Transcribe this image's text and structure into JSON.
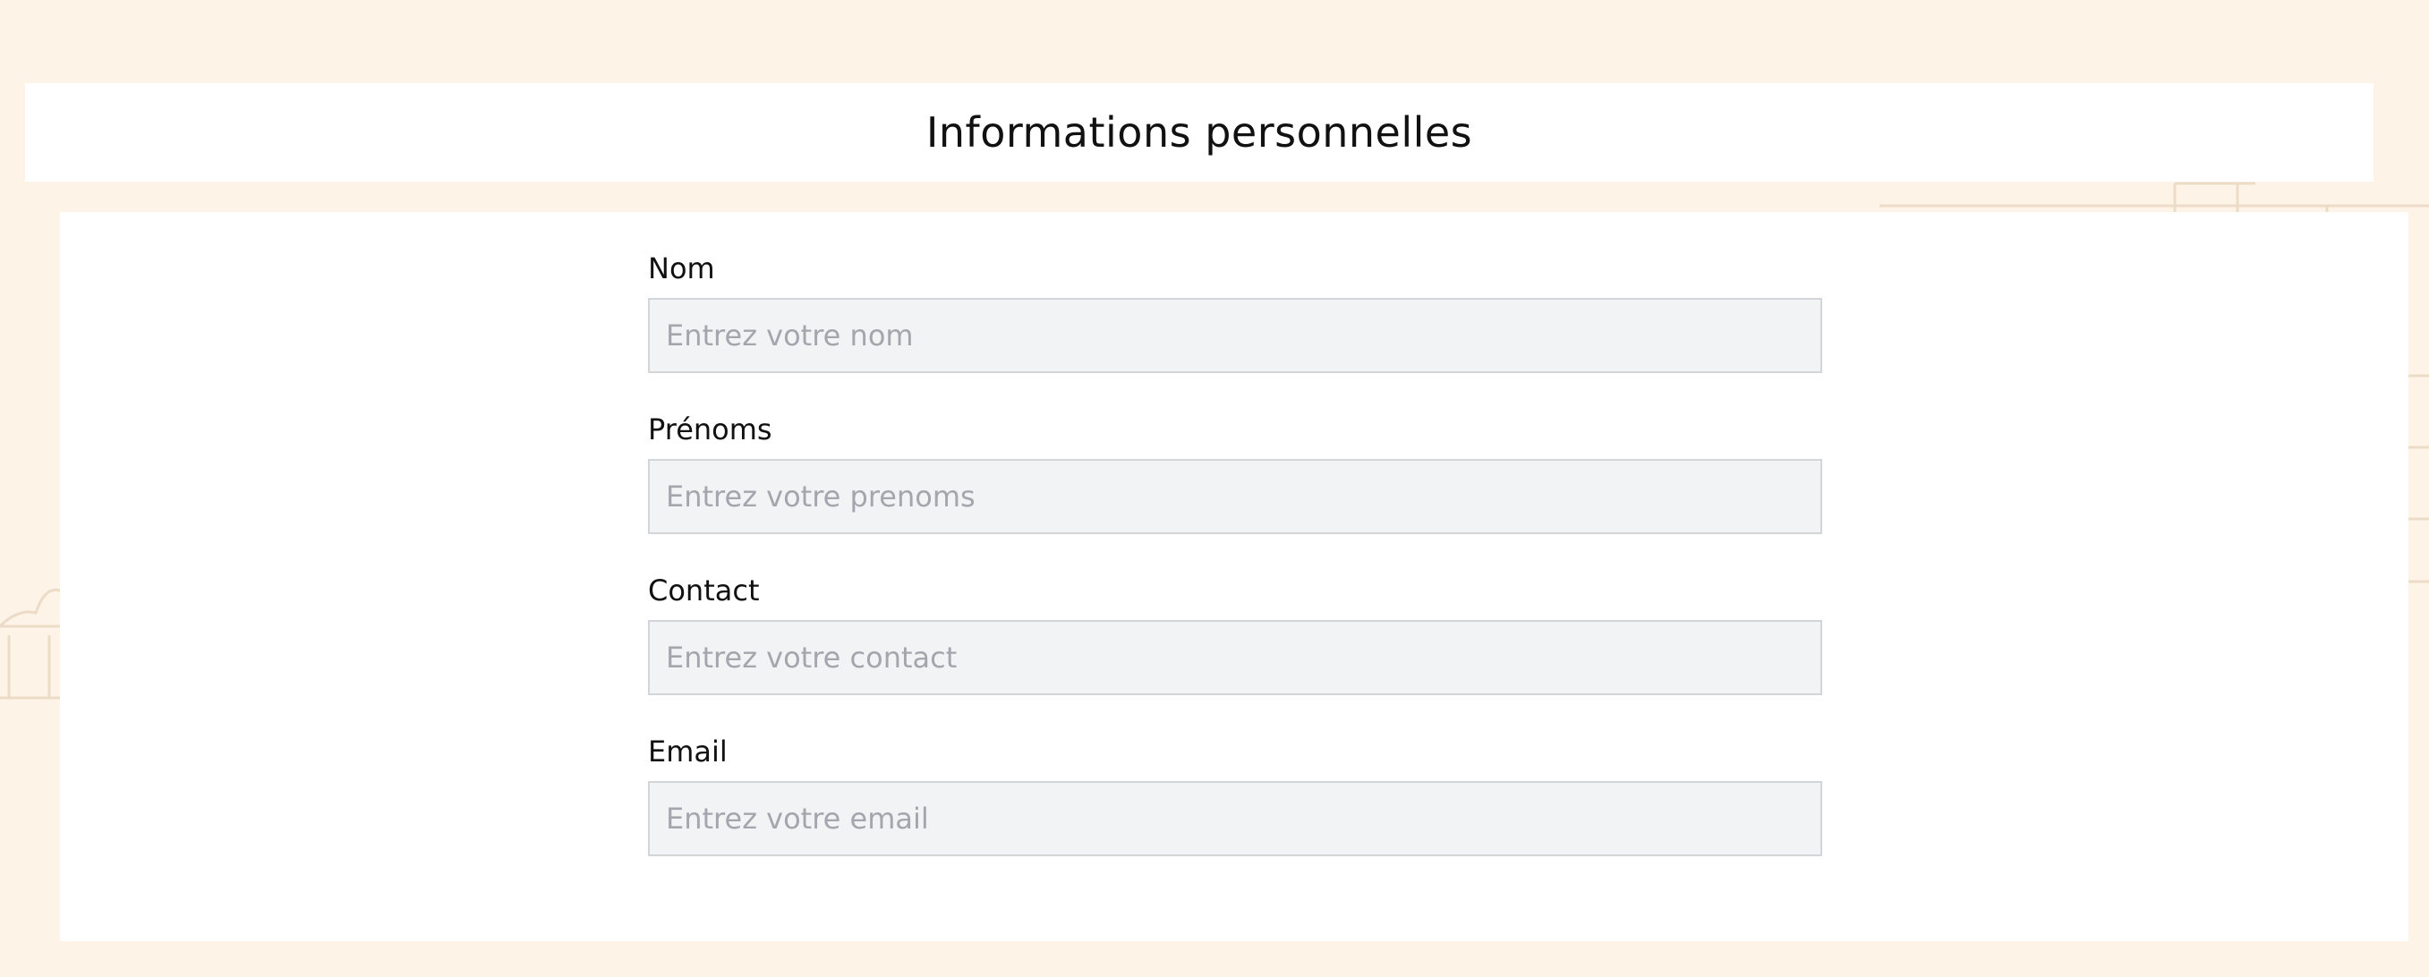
{
  "page": {
    "title": "Informations personnelles",
    "background_color": "#fdf3e6",
    "card_color": "#ffffff",
    "input_background": "#f2f3f5",
    "input_border": "#d3d5d9",
    "placeholder_color": "#a3a6ad"
  },
  "form": {
    "fields": [
      {
        "label": "Nom",
        "placeholder": "Entrez votre nom",
        "value": ""
      },
      {
        "label": "Prénoms",
        "placeholder": "Entrez votre prenoms",
        "value": ""
      },
      {
        "label": "Contact",
        "placeholder": "Entrez votre contact",
        "value": ""
      },
      {
        "label": "Email",
        "placeholder": "Entrez votre email",
        "value": ""
      }
    ]
  }
}
